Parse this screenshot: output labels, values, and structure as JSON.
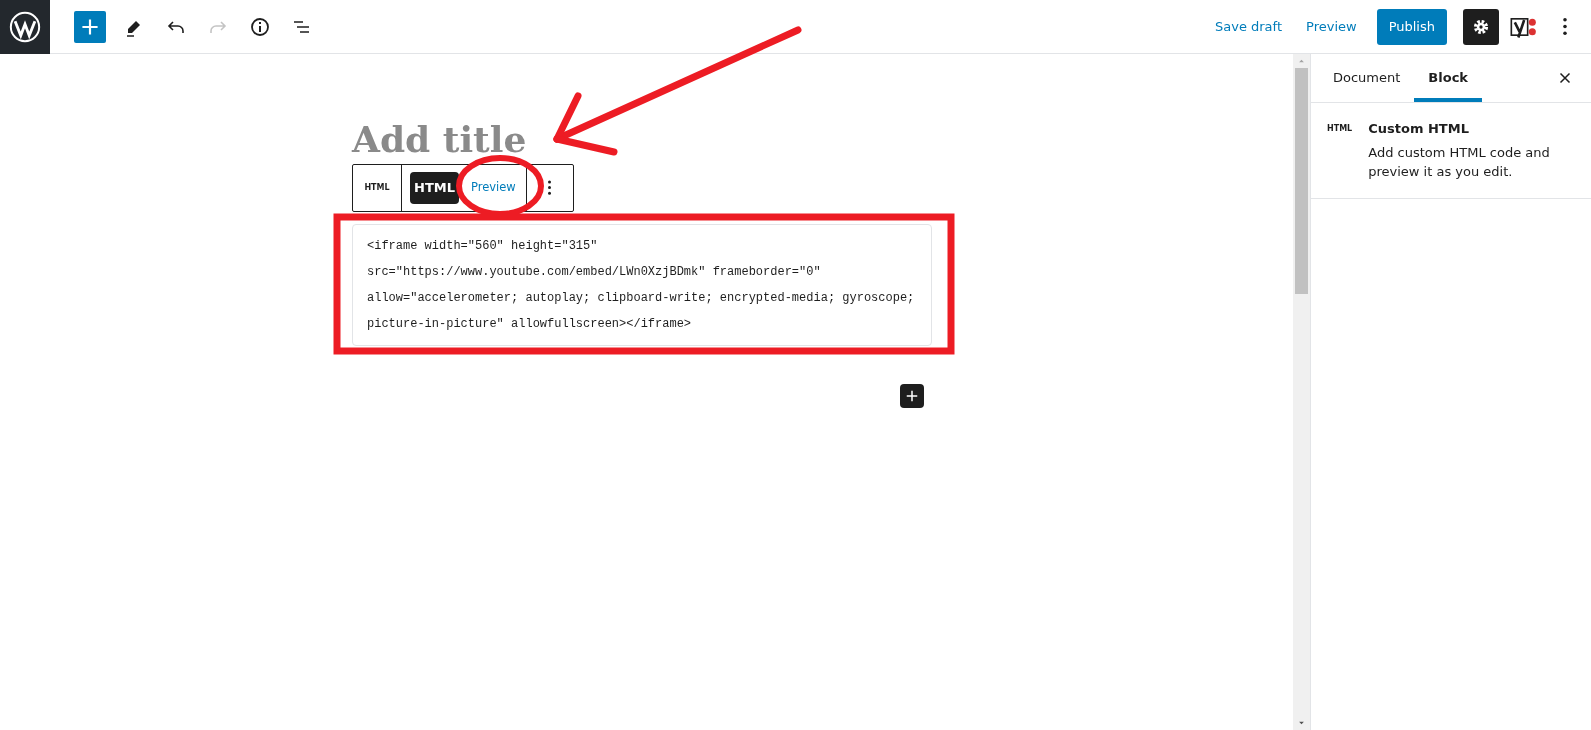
{
  "header": {
    "tools": [
      {
        "kind": "add",
        "disabled": false
      },
      {
        "kind": "edit",
        "disabled": false
      },
      {
        "kind": "undo",
        "disabled": false
      },
      {
        "kind": "redo",
        "disabled": true
      },
      {
        "kind": "info",
        "disabled": false
      },
      {
        "kind": "outline",
        "disabled": false
      }
    ],
    "save_draft": "Save draft",
    "preview": "Preview",
    "publish": "Publish",
    "settings": {
      "selected": true
    }
  },
  "editor": {
    "title_placeholder": "Add title",
    "block_toolbar": {
      "block_icon_label": "HTML",
      "modes": [
        {
          "label": "HTML",
          "selected": true
        },
        {
          "label": "Preview",
          "selected": false
        }
      ]
    },
    "code": [
      "<iframe width=\"560\" height=\"315\"",
      "src=\"https://www.youtube.com/embed/LWn0XzjBDmk\" frameborder=\"0\"",
      "allow=\"accelerometer; autoplay; clipboard-write; encrypted-media; gyroscope;",
      "picture-in-picture\" allowfullscreen></iframe>"
    ]
  },
  "sidebar": {
    "tabs": [
      {
        "label": "Document",
        "selected": false
      },
      {
        "label": "Block",
        "selected": true
      }
    ],
    "block_card": {
      "icon_label": "HTML",
      "title": "Custom HTML",
      "description": "Add custom HTML code and preview it as you edit."
    }
  },
  "annotations": [
    {
      "kind": "arrow"
    },
    {
      "kind": "circle"
    },
    {
      "kind": "rectangle"
    }
  ]
}
